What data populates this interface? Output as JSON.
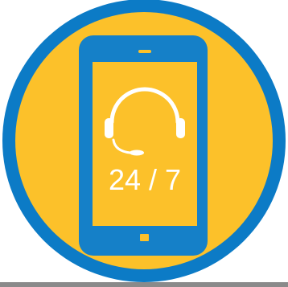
{
  "icon": {
    "name": "mobile-support-24-7-icon",
    "support_text": "24 / 7"
  },
  "colors": {
    "outer_ring": "#0c7bc6",
    "inner_disc": "#fcc12a",
    "phone_body": "#1580c8",
    "phone_screen": "#fcc12a",
    "headset": "#ffffff",
    "text": "#ffffff",
    "background": "#ffffff",
    "bottom_shadow": "#7f7f7f"
  },
  "icons": [
    "headset-icon",
    "home-button-icon",
    "speaker-slot-icon"
  ]
}
